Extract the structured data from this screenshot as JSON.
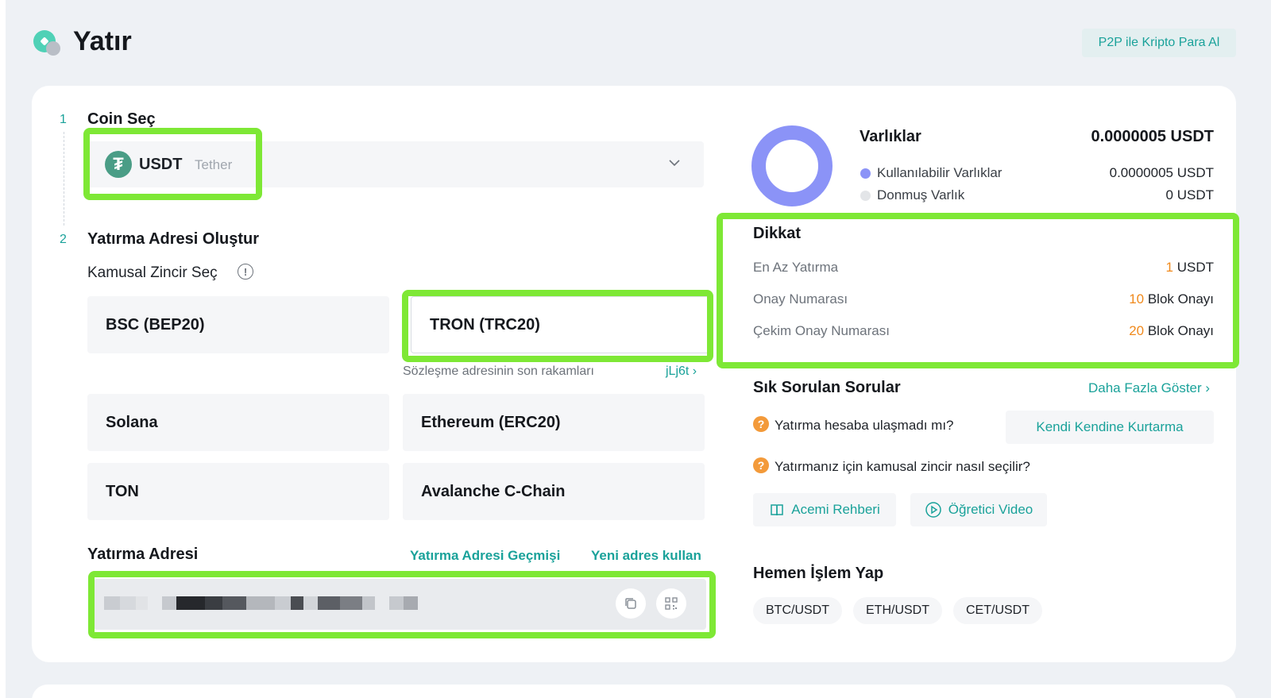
{
  "header": {
    "title": "Yatır",
    "p2p_label": "P2P ile Kripto Para Al"
  },
  "steps": {
    "step1": {
      "number": "1",
      "title": "Coin Seç"
    },
    "step2": {
      "number": "2",
      "title": "Yatırma Adresi Oluştur"
    }
  },
  "coin": {
    "symbol": "USDT",
    "name": "Tether",
    "icon": "tether-icon"
  },
  "chain": {
    "label": "Kamusal Zincir Seç",
    "options": [
      "BSC (BEP20)",
      "TRON (TRC20)",
      "Solana",
      "Ethereum (ERC20)",
      "TON",
      "Avalanche C-Chain"
    ],
    "selected": "TRON (TRC20)",
    "contract_hint": "Sözleşme adresinin son rakamları",
    "contract_suffix": "jLj6t"
  },
  "address": {
    "title": "Yatırma Adresi",
    "history_link": "Yatırma Adresi Geçmişi",
    "new_address_link": "Yeni adres kullan"
  },
  "assets": {
    "title": "Varlıklar",
    "total": "0.0000005 USDT",
    "available_label": "Kullanılabilir Varlıklar",
    "available_value": "0.0000005 USDT",
    "frozen_label": "Donmuş Varlık",
    "frozen_value": "0 USDT",
    "available_fraction": 1.0
  },
  "notice": {
    "title": "Dikkat",
    "min_deposit_label": "En Az Yatırma",
    "min_deposit_num": "1",
    "min_deposit_unit": "USDT",
    "confirm_label": "Onay Numarası",
    "confirm_num": "10",
    "confirm_unit": "Blok Onayı",
    "withdraw_confirm_label": "Çekim Onay Numarası",
    "withdraw_confirm_num": "20",
    "withdraw_confirm_unit": "Blok Onayı"
  },
  "faq": {
    "title": "Sık Sorulan Sorular",
    "more_label": "Daha Fazla Göster",
    "q1": "Yatırma hesaba ulaşmadı mı?",
    "q1_action": "Kendi Kendine Kurtarma",
    "q2": "Yatırmanız için kamusal zincir nasıl seçilir?",
    "guide_label": "Acemi Rehberi",
    "video_label": "Öğretici Video"
  },
  "trade": {
    "title": "Hemen İşlem Yap",
    "pairs": [
      "BTC/USDT",
      "ETH/USDT",
      "CET/USDT"
    ]
  },
  "colors": {
    "accent": "#1aa29a",
    "highlight": "#7ee835",
    "donut": "#8b93f7",
    "orange": "#f08a1d"
  }
}
